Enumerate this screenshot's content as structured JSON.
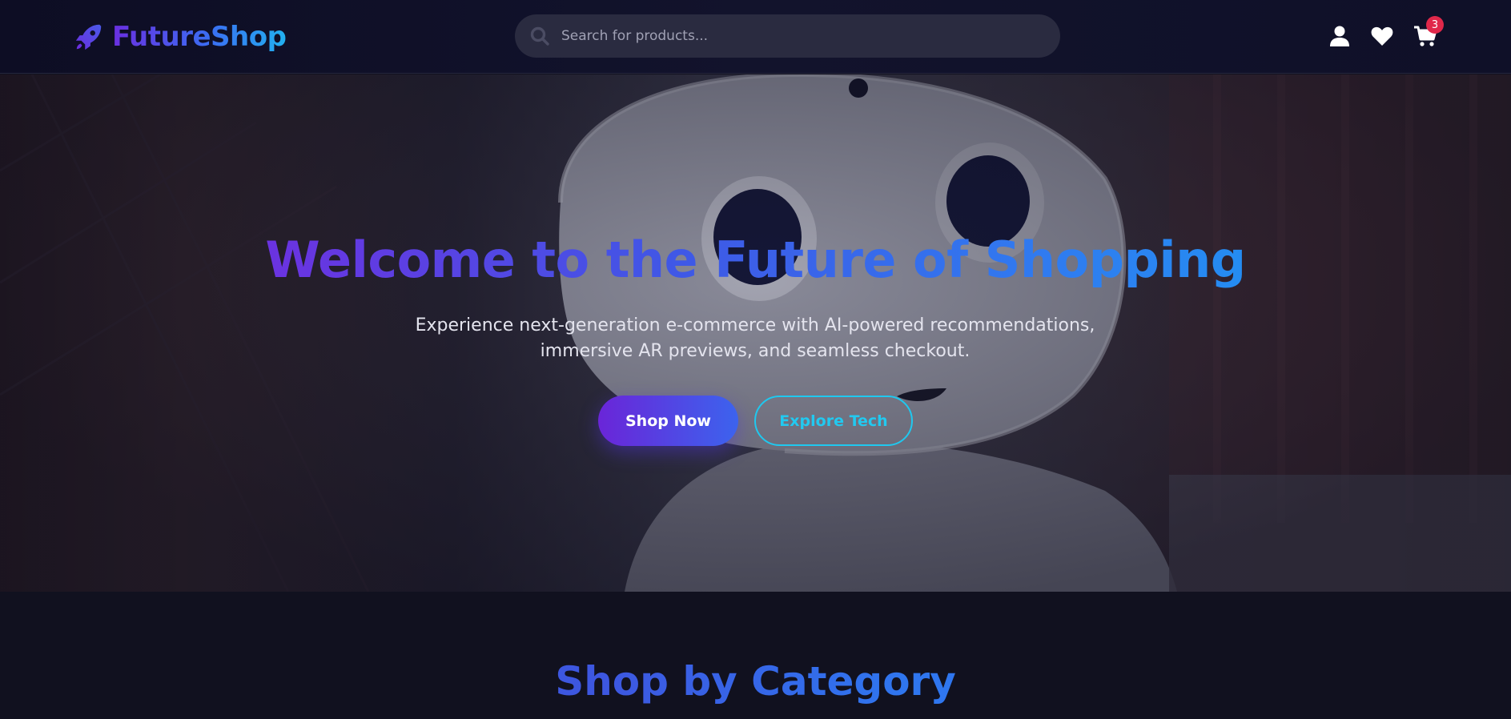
{
  "header": {
    "logo_text": "FutureShop",
    "logo_icon": "rocket-icon",
    "search": {
      "placeholder": "Search for products...",
      "value": ""
    },
    "icons": [
      "user-icon",
      "heart-icon",
      "cart-icon"
    ],
    "cart_count": "3"
  },
  "hero": {
    "title": "Welcome to the Future of Shopping",
    "subtitle_line1": "Experience next-generation e-commerce with AI-powered recommendations,",
    "subtitle_line2": "immersive AR previews, and seamless checkout.",
    "primary_button": "Shop Now",
    "secondary_button": "Explore Tech",
    "background": "robot-photo"
  },
  "categories": {
    "title": "Shop by Category"
  },
  "colors": {
    "background": "#11111f",
    "header": "#0f1028",
    "accent_purple": "#6a25d8",
    "accent_blue": "#3c63ee",
    "accent_cyan": "#22c9f0",
    "badge": "#e0284a"
  }
}
